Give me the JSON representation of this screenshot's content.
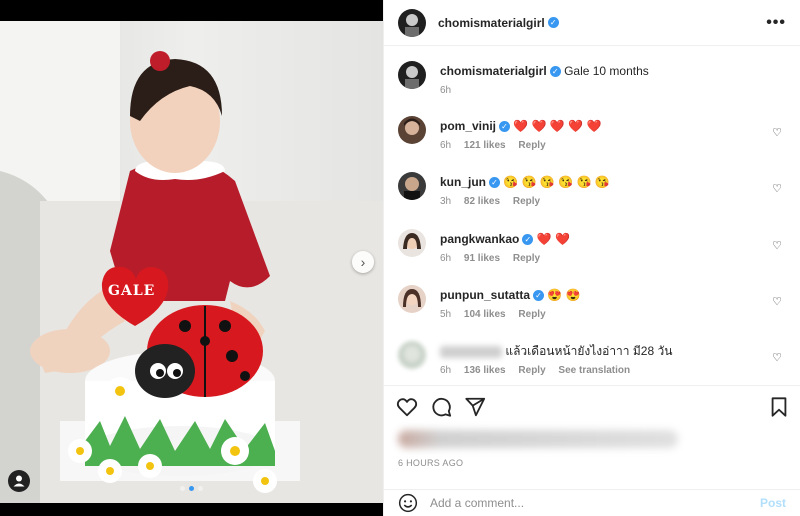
{
  "post": {
    "author": "chomismaterialgirl",
    "caption": "Gale 10 months",
    "caption_time": "6h",
    "time_ago": "6 HOURS AGO",
    "more_label": "•••",
    "cake_text": "GALE"
  },
  "comments": [
    {
      "user": "pom_vinij",
      "verified": true,
      "text": "❤️ ❤️ ❤️ ❤️ ❤️",
      "time": "6h",
      "likes": "121 likes",
      "reply": "Reply",
      "extra": ""
    },
    {
      "user": "kun_jun",
      "verified": true,
      "text": "😘 😘 😘 😘 😘 😘",
      "time": "3h",
      "likes": "82 likes",
      "reply": "Reply",
      "extra": ""
    },
    {
      "user": "pangkwankao",
      "verified": true,
      "text": "❤️ ❤️",
      "time": "6h",
      "likes": "91 likes",
      "reply": "Reply",
      "extra": ""
    },
    {
      "user": "punpun_sutatta",
      "verified": true,
      "text": "😍 😍",
      "time": "5h",
      "likes": "104 likes",
      "reply": "Reply",
      "extra": ""
    },
    {
      "user": "",
      "verified": false,
      "text": "แล้วเดือนหน้ายังไงอ่าาา มี28 วัน",
      "time": "6h",
      "likes": "136 likes",
      "reply": "Reply",
      "extra": "See translation"
    }
  ],
  "add_comment": {
    "placeholder": "Add a comment...",
    "post_label": "Post"
  },
  "icons": {
    "verified": "verified-badge-icon",
    "more": "more-options-icon",
    "like": "heart-icon",
    "comment": "comment-icon",
    "share": "share-icon",
    "save": "bookmark-icon",
    "emoji": "emoji-icon",
    "next": "chevron-right-icon",
    "tag": "user-tag-icon"
  },
  "colors": {
    "accent": "#3897f0",
    "post_disabled": "#b2dffc",
    "meta": "#8e8e8e"
  },
  "carousel": {
    "count": 3,
    "active": 1
  }
}
